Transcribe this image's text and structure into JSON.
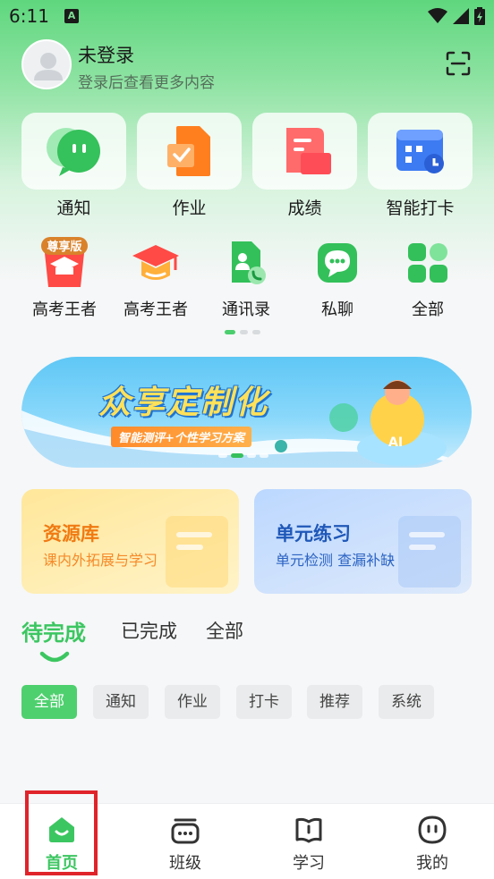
{
  "status_bar": {
    "time": "6:11",
    "sim_badge": "A"
  },
  "header": {
    "title": "未登录",
    "subtitle": "登录后查看更多内容",
    "scan_icon": "scan-icon"
  },
  "quick_tiles": [
    {
      "label": "通知",
      "icon": "chat-bubble-icon"
    },
    {
      "label": "作业",
      "icon": "homework-icon"
    },
    {
      "label": "成绩",
      "icon": "grade-icon"
    },
    {
      "label": "智能打卡",
      "icon": "calendar-icon"
    }
  ],
  "shortcuts": [
    {
      "label": "高考王者",
      "icon": "graduation-cap-premium-icon",
      "badge": "尊享版"
    },
    {
      "label": "高考王者",
      "icon": "graduation-cap-icon"
    },
    {
      "label": "通讯录",
      "icon": "contacts-icon"
    },
    {
      "label": "私聊",
      "icon": "message-icon"
    },
    {
      "label": "全部",
      "icon": "grid-icon"
    }
  ],
  "banner": {
    "title": "众享定制化",
    "subtitle": "智能测评+个性学习方案",
    "badge_text": "AI"
  },
  "cards": {
    "resource": {
      "title": "资源库",
      "subtitle": "课内外拓展与学习",
      "color": "#f07a12"
    },
    "unit": {
      "title": "单元练习",
      "subtitle": "单元检测 查漏补缺",
      "color": "#1f58b8"
    }
  },
  "tabs": [
    {
      "label": "待完成",
      "active": true
    },
    {
      "label": "已完成",
      "active": false
    },
    {
      "label": "全部",
      "active": false
    }
  ],
  "chips": [
    {
      "label": "全部",
      "active": true
    },
    {
      "label": "通知",
      "active": false
    },
    {
      "label": "作业",
      "active": false
    },
    {
      "label": "打卡",
      "active": false
    },
    {
      "label": "推荐",
      "active": false
    },
    {
      "label": "系统",
      "active": false
    }
  ],
  "bottom_nav": [
    {
      "label": "首页",
      "icon": "home-icon",
      "active": true
    },
    {
      "label": "班级",
      "icon": "class-icon",
      "active": false
    },
    {
      "label": "学习",
      "icon": "book-icon",
      "active": false
    },
    {
      "label": "我的",
      "icon": "profile-icon",
      "active": false
    }
  ],
  "colors": {
    "accent": "#3cc661",
    "highlight": "#e0232b"
  }
}
